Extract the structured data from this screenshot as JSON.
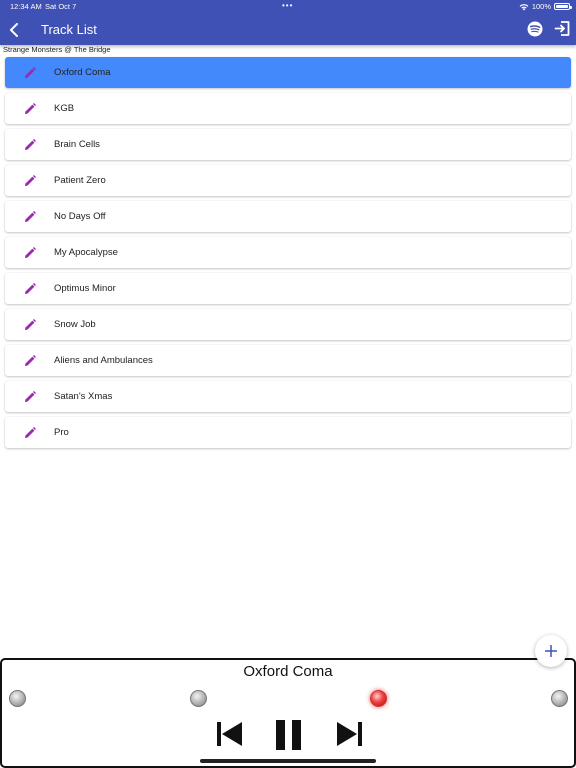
{
  "status_bar": {
    "time": "12:34 AM",
    "date": "Sat Oct 7",
    "dots": "•••",
    "battery": "100%"
  },
  "header": {
    "title": "Track List",
    "subtitle": "Strange Monsters @ The Bridge"
  },
  "tracks": [
    {
      "label": "Oxford Coma",
      "selected": true
    },
    {
      "label": "KGB"
    },
    {
      "label": "Brain Cells"
    },
    {
      "label": "Patient Zero"
    },
    {
      "label": "No Days Off"
    },
    {
      "label": "My Apocalypse"
    },
    {
      "label": "Optimus Minor"
    },
    {
      "label": "Snow Job"
    },
    {
      "label": "Aliens and Ambulances"
    },
    {
      "label": "Satan's Xmas"
    },
    {
      "label": "Pro"
    }
  ],
  "player": {
    "now_playing": "Oxford Coma",
    "active_indicator": 3
  },
  "icons": {
    "back": "chevron-left-icon",
    "spotify": "spotify-icon",
    "exit": "exit-icon",
    "edit": "pencil-icon",
    "add": "plus-icon",
    "previous": "skip-previous-icon",
    "pause": "pause-icon",
    "next": "skip-next-icon"
  },
  "colors": {
    "app_bar": "#4051b5",
    "selected_row": "#4489fb",
    "edit_icon": "#9c27b0",
    "add_icon": "#3f51b5",
    "led_active": "#f04040"
  }
}
